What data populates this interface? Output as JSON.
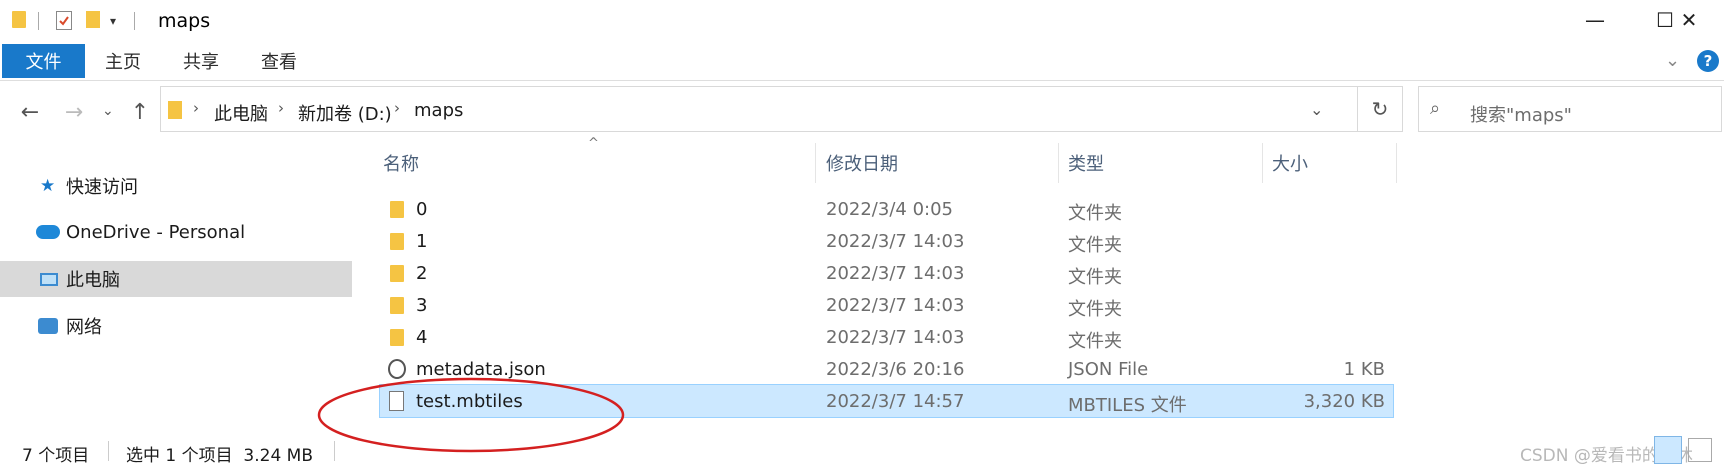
{
  "window": {
    "title": "maps",
    "minimize_glyph": "—",
    "maximize_glyph": "☐",
    "close_glyph": "✕"
  },
  "ribbon": {
    "tabs": [
      {
        "label": "文件",
        "active": true
      },
      {
        "label": "主页"
      },
      {
        "label": "共享"
      },
      {
        "label": "查看"
      }
    ]
  },
  "address": {
    "crumbs": [
      "此电脑",
      "新加卷 (D:)",
      "maps"
    ],
    "search_placeholder": "搜索\"maps\""
  },
  "nav_pane": {
    "items": [
      {
        "label": "快速访问",
        "icon": "star-icon"
      },
      {
        "label": "OneDrive - Personal",
        "icon": "cloud-icon"
      },
      {
        "label": "此电脑",
        "icon": "computer-icon",
        "selected": true
      },
      {
        "label": "网络",
        "icon": "network-icon"
      }
    ]
  },
  "columns": {
    "name": "名称",
    "date": "修改日期",
    "type": "类型",
    "size": "大小"
  },
  "files": [
    {
      "name": "0",
      "date": "2022/3/4 0:05",
      "type": "文件夹",
      "size": "",
      "icon": "folder-icon"
    },
    {
      "name": "1",
      "date": "2022/3/7 14:03",
      "type": "文件夹",
      "size": "",
      "icon": "folder-icon"
    },
    {
      "name": "2",
      "date": "2022/3/7 14:03",
      "type": "文件夹",
      "size": "",
      "icon": "folder-icon"
    },
    {
      "name": "3",
      "date": "2022/3/7 14:03",
      "type": "文件夹",
      "size": "",
      "icon": "folder-icon"
    },
    {
      "name": "4",
      "date": "2022/3/7 14:03",
      "type": "文件夹",
      "size": "",
      "icon": "folder-icon"
    },
    {
      "name": "metadata.json",
      "date": "2022/3/6 20:16",
      "type": "JSON File",
      "size": "1 KB",
      "icon": "json-file-icon"
    },
    {
      "name": "test.mbtiles",
      "date": "2022/3/7 14:57",
      "type": "MBTILES 文件",
      "size": "3,320 KB",
      "icon": "file-icon",
      "selected": true
    }
  ],
  "status": {
    "count": "7 个项目",
    "selection": "选中 1 个项目  3.24 MB"
  },
  "watermark": "CSDN @爱看书的小沐",
  "colors": {
    "accent": "#1979ca",
    "selection": "#cce8ff",
    "annotation": "#d42020",
    "folder": "#f5c443"
  }
}
